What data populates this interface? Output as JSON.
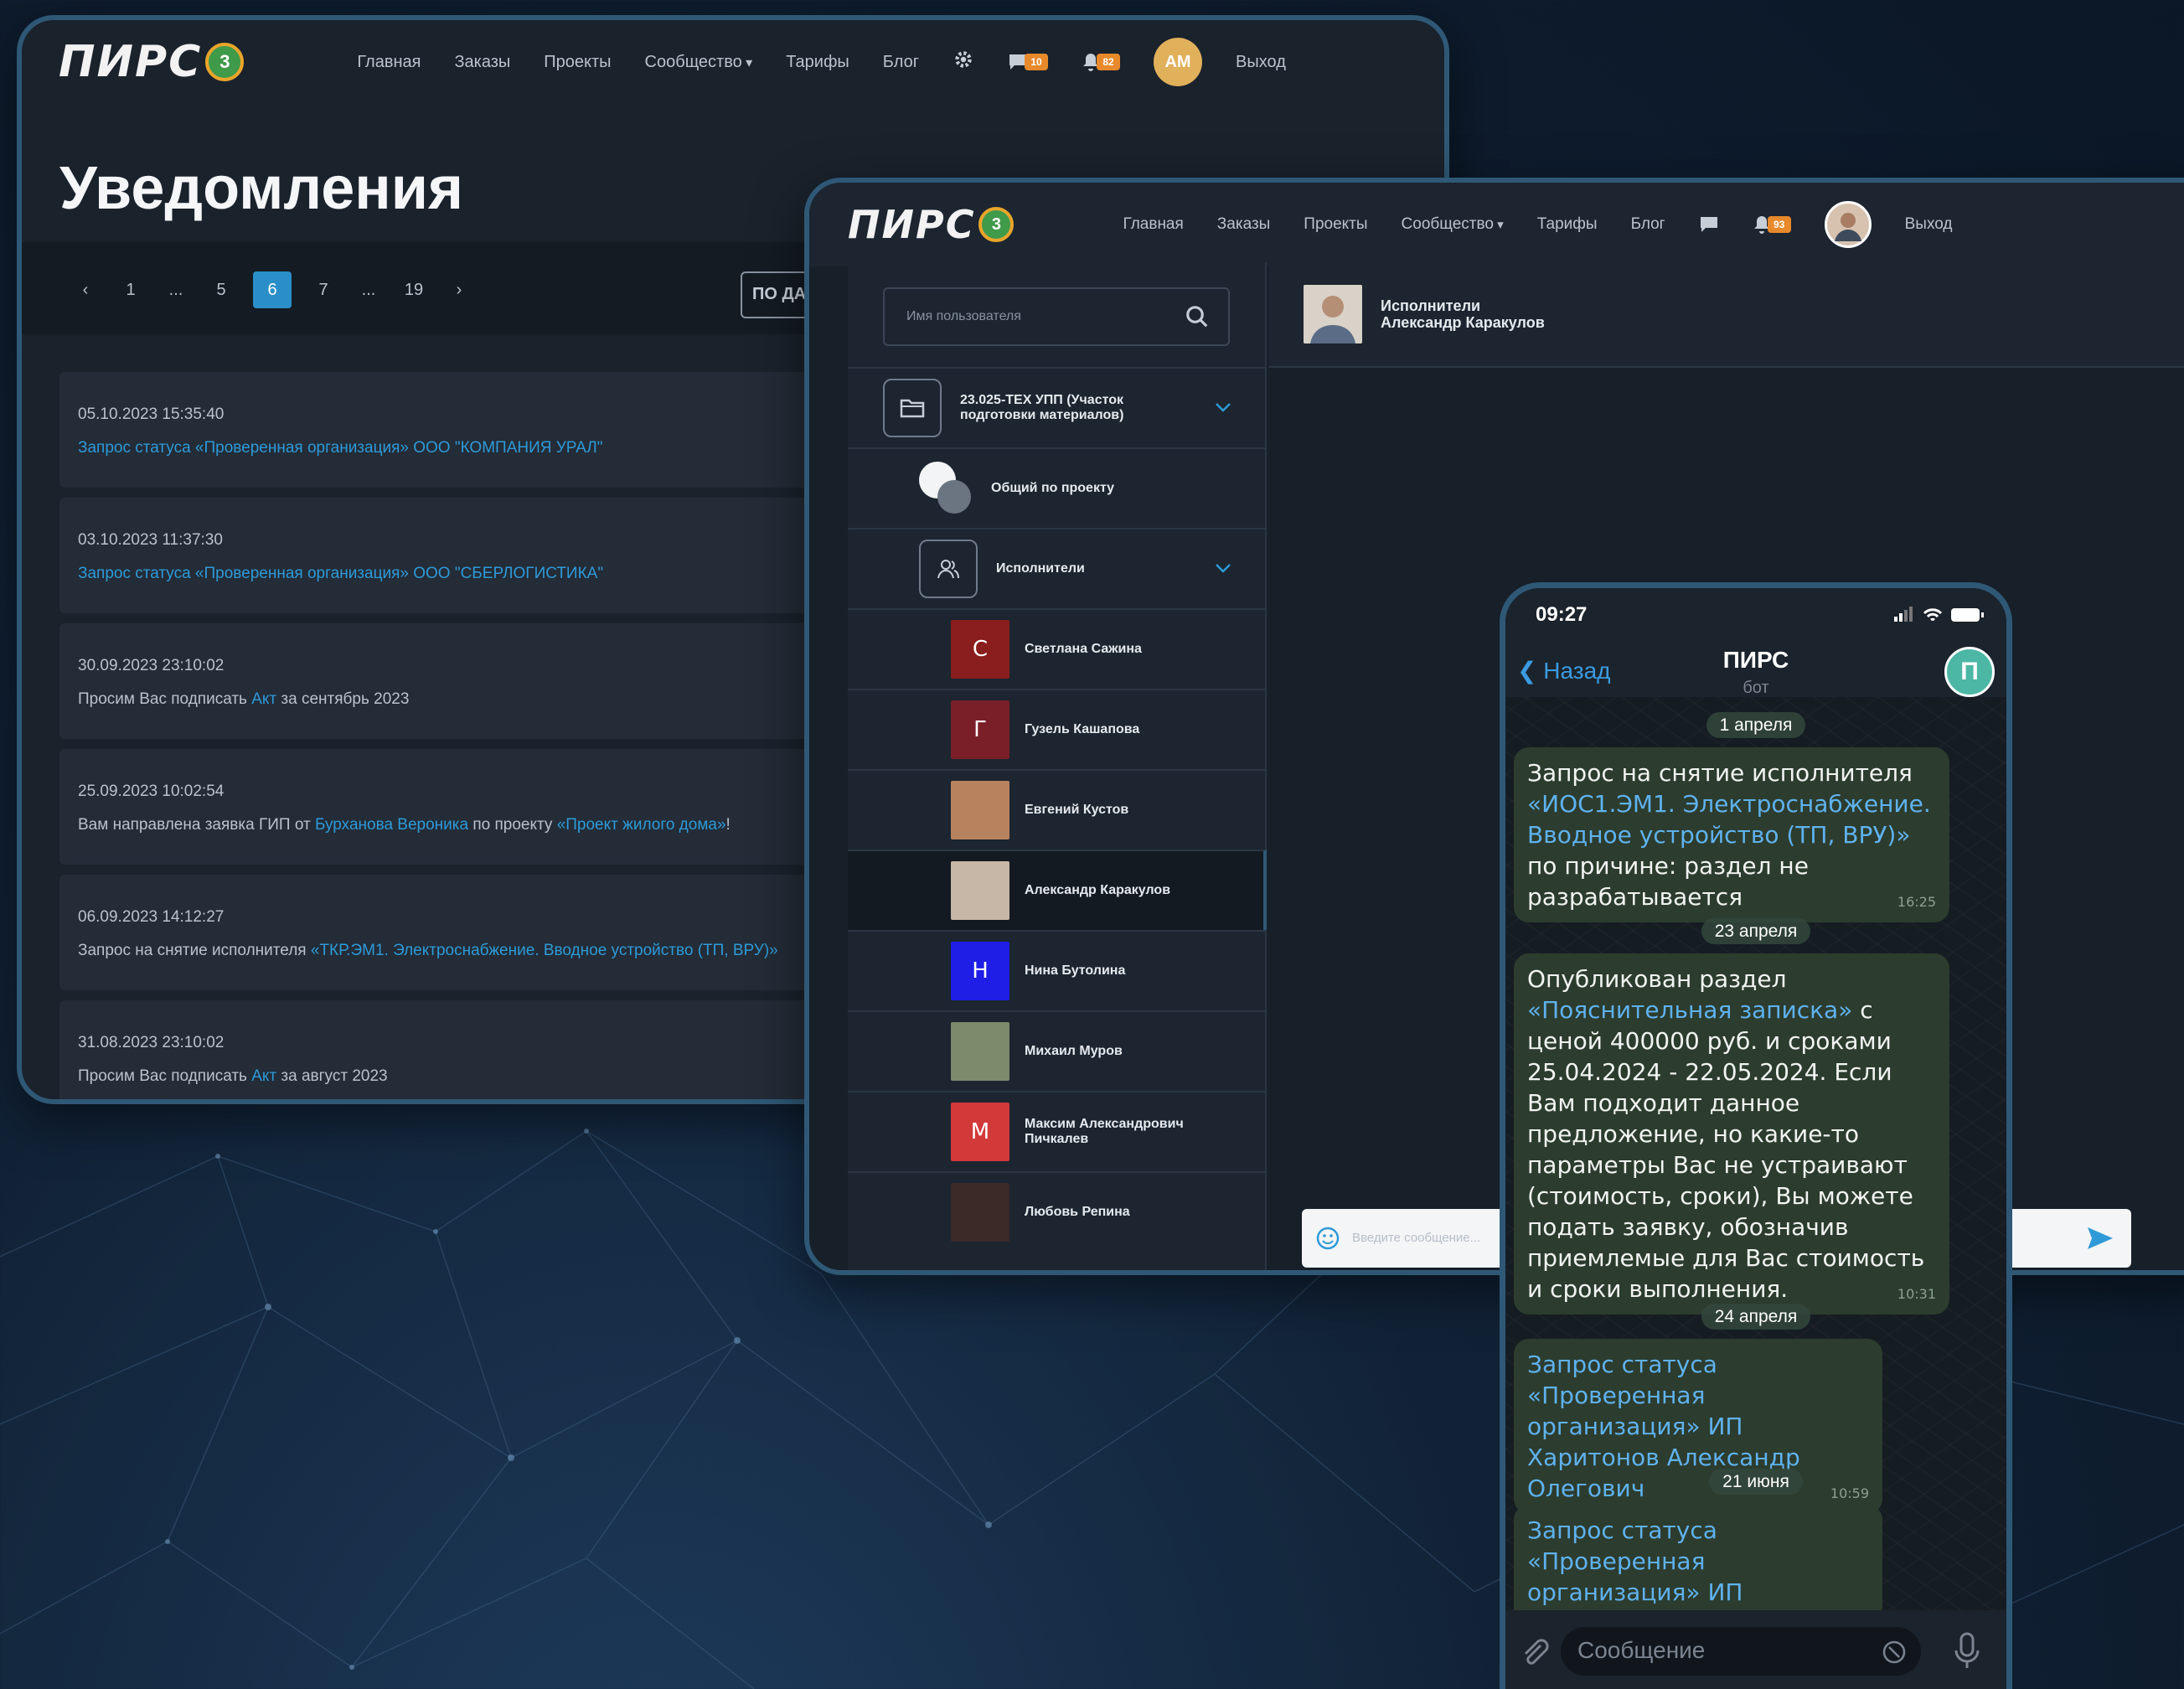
{
  "brand": {
    "logo_text": "ПИРС",
    "logo_badge": "3",
    "accent": "#2a8fc9",
    "badge_color": "#e8892b"
  },
  "nav1": {
    "items": [
      "Главная",
      "Заказы",
      "Проекты",
      "Сообщество",
      "Тарифы",
      "Блог"
    ],
    "messages_count": "10",
    "notifications_count": "82",
    "avatar_initials": "АМ",
    "logout": "Выход"
  },
  "notifications_page": {
    "title": "Уведомления",
    "pager": [
      "1",
      "...",
      "5",
      "6",
      "7",
      "...",
      "19"
    ],
    "pager_active": "6",
    "sort_label": "ПО ДАТ",
    "items": [
      {
        "date": "05.10.2023 15:35:40",
        "parts": [
          "",
          "Запрос статуса «Проверенная организация» ООО \"КОМПАНИЯ УРАЛ\"",
          ""
        ]
      },
      {
        "date": "03.10.2023 11:37:30",
        "parts": [
          "",
          "Запрос статуса «Проверенная организация» ООО \"СБЕРЛОГИСТИКА\"",
          ""
        ]
      },
      {
        "date": "30.09.2023 23:10:02",
        "parts": [
          "Просим Вас подписать ",
          "Акт",
          " за сентябрь 2023"
        ]
      },
      {
        "date": "25.09.2023 10:02:54",
        "parts": [
          "Вам направлена заявка ГИП от ",
          "Бурханова Вероника",
          " по проекту ",
          "«Проект жилого дома»",
          "!"
        ]
      },
      {
        "date": "06.09.2023 14:12:27",
        "parts": [
          "Запрос на снятие исполнителя ",
          "«ТКР.ЭМ1. Электроснабжение. Вводное устройство (ТП, ВРУ)»",
          ""
        ]
      },
      {
        "date": "31.08.2023 23:10:02",
        "parts": [
          "Просим Вас подписать ",
          "Акт",
          " за август 2023"
        ]
      }
    ]
  },
  "nav2": {
    "items": [
      "Главная",
      "Заказы",
      "Проекты",
      "Сообщество",
      "Тарифы",
      "Блог"
    ],
    "notifications_count": "93",
    "logout": "Выход"
  },
  "chat_app": {
    "search_placeholder": "Имя пользователя",
    "project": "23.025-ТЕХ УПП (Участок подготовки материалов)",
    "general": "Общий по проекту",
    "group": "Исполнители",
    "members": [
      {
        "initial": "С",
        "name": "Светлана Сажина",
        "color": "#8a1d1d"
      },
      {
        "initial": "Г",
        "name": "Гузель Кашапова",
        "color": "#7a1f27"
      },
      {
        "initial": "",
        "name": "Евгений Кустов",
        "color": "#b9825f"
      },
      {
        "initial": "",
        "name": "Александр Каракулов",
        "color": "#c7b7a6"
      },
      {
        "initial": "Н",
        "name": "Нина Бутолина",
        "color": "#1e1ee6"
      },
      {
        "initial": "",
        "name": "Михаил Муров",
        "color": "#7d8a6c"
      },
      {
        "initial": "М",
        "name": "Максим Александрович Пичкалев",
        "color": "#d23a3a"
      },
      {
        "initial": "",
        "name": "Любовь Репина",
        "color": "#3c2a26"
      }
    ],
    "chat_title_line1": "Исполнители",
    "chat_title_line2": "Александр Каракулов",
    "input_placeholder": "Введите сообщение..."
  },
  "phone": {
    "time": "09:27",
    "back": "Назад",
    "title": "ПИРС",
    "subtitle": "бот",
    "messages": [
      {
        "date": "1 апреля",
        "parts": [
          "Запрос на снятие исполнителя ",
          "«ИОС1.ЭМ1. Электроснабжение. Вводное устройство (ТП, ВРУ)»",
          " по причине: раздел не разрабатывается"
        ],
        "time": "16:25"
      },
      {
        "date": "23 апреля",
        "parts": [
          "Опубликован раздел ",
          "«Пояснительная записка»",
          " с ценой 400000 руб. и сроками 25.04.2024 - 22.05.2024. Если Вам подходит данное предложение, но какие-то параметры Вас не устраивают (стоимость, сроки), Вы можете подать заявку, обозначив приемлемые для Вас стоимость и сроки выполнения."
        ],
        "time": "10:31"
      },
      {
        "date": "24 апреля",
        "parts": [
          "",
          "Запрос статуса «Проверенная организация» ИП Харитонов Александр Олегович",
          ""
        ],
        "time": "10:59"
      },
      {
        "date": "21 июня",
        "parts": [
          "",
          "Запрос статуса «Проверенная организация» ИП Дорофеев",
          ""
        ],
        "time": ""
      }
    ],
    "compose_placeholder": "Сообщение"
  }
}
